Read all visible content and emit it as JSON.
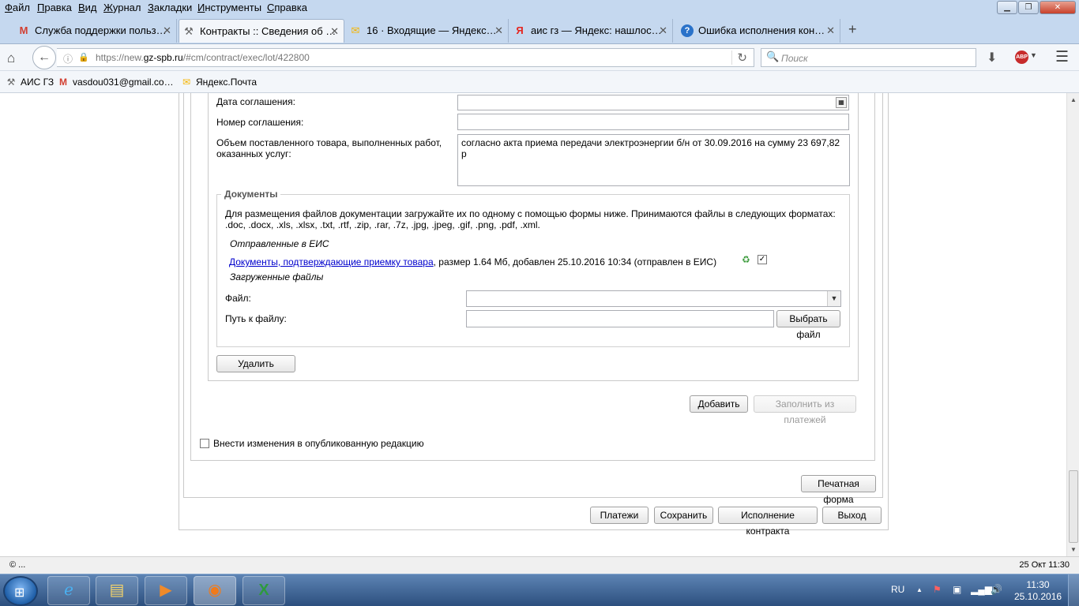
{
  "menu": {
    "items": [
      {
        "u": "Ф",
        "rest": "айл"
      },
      {
        "u": "П",
        "rest": "равка"
      },
      {
        "u": "В",
        "rest": "ид"
      },
      {
        "u": "Ж",
        "rest": "урнал"
      },
      {
        "u": "З",
        "rest": "акладки"
      },
      {
        "u": "И",
        "rest": "нструменты"
      },
      {
        "u": "С",
        "rest": "правка"
      }
    ]
  },
  "tabs": [
    {
      "label": "Служба поддержки польз…",
      "icon": "gmail-icon",
      "glyph": "M"
    },
    {
      "label": "Контракты :: Сведения об …",
      "icon": "tools-icon",
      "glyph": "⚒"
    },
    {
      "label": "16 · Входящие — Яндекс…",
      "icon": "yandex-mail-icon",
      "glyph": "✉"
    },
    {
      "label": "аис гз — Яндекс: нашлос…",
      "icon": "yandex-icon",
      "glyph": "Я"
    },
    {
      "label": "Ошибка исполнения кон…",
      "icon": "help-icon",
      "glyph": "?"
    }
  ],
  "nav": {
    "url_prefix": "https://new.",
    "url_domain": "gz-spb.ru",
    "url_rest": "/#cm/contract/exec/lot/422800",
    "search_placeholder": "Поиск",
    "abp_label": "ABP"
  },
  "bookmarks": [
    {
      "label": "АИС ГЗ",
      "glyph": "⚒"
    },
    {
      "label": "vasdou031@gmail.co…",
      "glyph": "M"
    },
    {
      "label": "Яндекс.Почта",
      "glyph": "✉"
    }
  ],
  "form": {
    "date_label": "Дата соглашения:",
    "date_value": "",
    "number_label": "Номер соглашения:",
    "number_value": "",
    "volume_label": "Объем поставленного товара, выполненных работ, оказанных услуг:",
    "volume_value": "согласно акта приема передачи электроэнергии б/н от 30.09.2016 на сумму 23 697,82 р",
    "documents_legend": "Документы",
    "documents_hint": "Для размещения файлов документации загружайте их по одному с помощью формы ниже. Принимаются файлы в следующих форматах: .doc, .docx, .xls, .xlsx, .txt, .rtf, .zip, .rar, .7z, .jpg, .jpeg, .gif, .png, .pdf, .xml.",
    "sent_heading": "Отправленные в ЕИС",
    "doc_link": "Документы, подтверждающие приемку товара",
    "doc_meta": ", размер 1.64 Мб, добавлен 25.10.2016 10:34 (отправлен в ЕИС)",
    "doc_checked": true,
    "uploaded_heading": "Загруженные файлы",
    "file_label": "Файл:",
    "file_value": "",
    "path_label": "Путь к файлу:",
    "path_value": "",
    "choose_file_btn": "Выбрать файл",
    "delete_btn": "Удалить",
    "add_btn": "Добавить",
    "fill_from_payments_btn": "Заполнить из платежей",
    "publish_changes_label": "Внести изменения в опубликованную редакцию",
    "publish_changes_checked": false,
    "print_form_btn": "Печатная форма"
  },
  "footer_buttons": {
    "payments": "Платежи",
    "save": "Сохранить",
    "contract_execution": "Исполнение контракта",
    "exit": "Выход"
  },
  "statusbar": {
    "left": "© ...",
    "right": "25 Окт 11:30"
  },
  "taskbar": {
    "lang": "RU",
    "time": "11:30",
    "date": "25.10.2016"
  }
}
